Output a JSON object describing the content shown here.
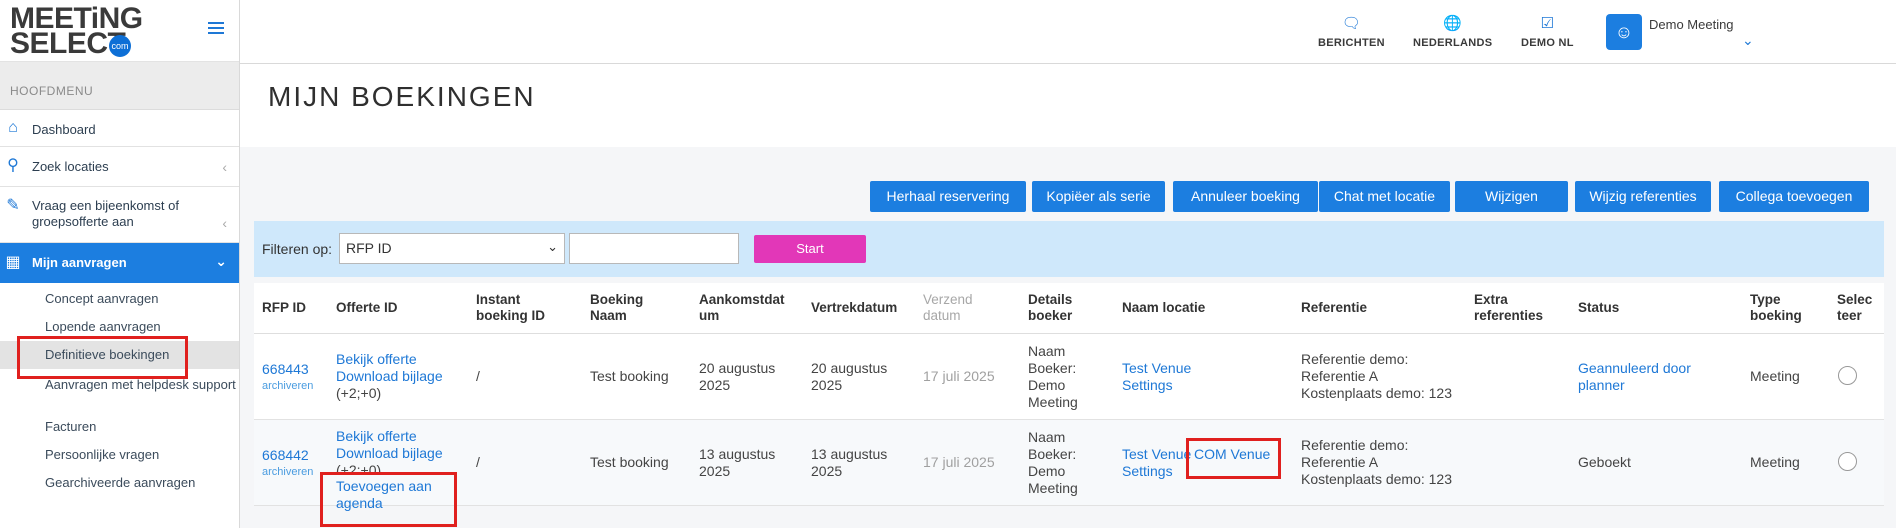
{
  "logo": {
    "line1": "MEETiNG",
    "line2": "SELECT",
    "badge": "com"
  },
  "sidebar": {
    "menu_title": "HOOFDMENU",
    "items": [
      {
        "label": "Dashboard",
        "icon": "home-icon"
      },
      {
        "label": "Zoek locaties",
        "icon": "search-icon"
      },
      {
        "label": "Vraag een bijeenkomst of groepsofferte aan",
        "icon": "edit-icon"
      },
      {
        "label": "Mijn aanvragen",
        "icon": "grid-icon"
      }
    ],
    "sub_items": [
      {
        "label": "Concept aanvragen"
      },
      {
        "label": "Lopende aanvragen"
      },
      {
        "label": "Definitieve boekingen"
      },
      {
        "label": "Aanvragen met helpdesk support"
      },
      {
        "label": "Facturen"
      },
      {
        "label": "Persoonlijke vragen"
      },
      {
        "label": "Gearchiveerde aanvragen"
      }
    ]
  },
  "topbar": {
    "berichten": "BERICHTEN",
    "taal": "NEDERLANDS",
    "demo": "DEMO NL",
    "user": "Demo Meeting"
  },
  "page": {
    "title": "MIJN BOEKINGEN"
  },
  "actions": [
    "Herhaal reservering",
    "Kopiëer als serie",
    "Annuleer boeking",
    "Chat met locatie",
    "Wijzigen",
    "Wijzig referenties",
    "Collega toevoegen"
  ],
  "filter": {
    "label": "Filteren op:",
    "selected": "RFP ID",
    "value": "",
    "start": "Start"
  },
  "table": {
    "headers": {
      "rfp": "RFP ID",
      "offerte": "Offerte ID",
      "instant1": "Instant",
      "instant2": "boeking ID",
      "naam1": "Boeking",
      "naam2": "Naam",
      "aankomst1": "Aankomstdat",
      "aankomst2": "um",
      "vertrek": "Vertrekdatum",
      "verzend1": "Verzend",
      "verzend2": "datum",
      "details1": "Details",
      "details2": "boeker",
      "locatie": "Naam locatie",
      "referentie": "Referentie",
      "extra1": "Extra",
      "extra2": "referenties",
      "status": "Status",
      "type1": "Type",
      "type2": "boeking",
      "select1": "Selec",
      "select2": "teer"
    },
    "rows": [
      {
        "rfp": "668443",
        "archive": "archiveren",
        "offerte_view": "Bekijk offerte",
        "offerte_download": "Download bijlage",
        "offerte_extra": "(+2;+0)",
        "instant": "/",
        "naam": "Test booking",
        "aankomst1": "20 augustus",
        "aankomst2": "2025",
        "vertrek1": "20 augustus",
        "vertrek2": "2025",
        "verzend": "17 juli 2025",
        "boeker1": "Naam",
        "boeker2": "Boeker:",
        "boeker3": "Demo",
        "boeker4": "Meeting",
        "locatie1": "Test Venue",
        "locatie2": "Settings",
        "ref1": "Referentie demo:",
        "ref2": "Referentie A",
        "ref3": "Kostenplaats demo: 123",
        "extra": "",
        "status1": "Geannuleerd door",
        "status2": "planner",
        "type": "Meeting"
      },
      {
        "rfp": "668442",
        "archive": "archiveren",
        "offerte_view": "Bekijk offerte",
        "offerte_download": "Download bijlage",
        "offerte_extra": "(+2;+0)",
        "agenda1": "Toevoegen aan",
        "agenda2": "agenda",
        "instant": "/",
        "naam": "Test booking",
        "aankomst1": "13 augustus",
        "aankomst2": "2025",
        "vertrek1": "13 augustus",
        "vertrek2": "2025",
        "verzend": "17 juli 2025",
        "boeker1": "Naam",
        "boeker2": "Boeker:",
        "boeker3": "Demo",
        "boeker4": "Meeting",
        "locatie1": "Test Venue",
        "locatie2": "Settings",
        "locatie_chat": "COM Venue",
        "ref1": "Referentie demo:",
        "ref2": "Referentie A",
        "ref3": "Kostenplaats demo: 123",
        "extra": "",
        "status": "Geboekt",
        "type": "Meeting"
      }
    ]
  },
  "colors": {
    "accent": "#1c7ee0",
    "start": "#e237b8",
    "highlight": "#e0201e",
    "filter_bg": "#cfe8fb"
  }
}
